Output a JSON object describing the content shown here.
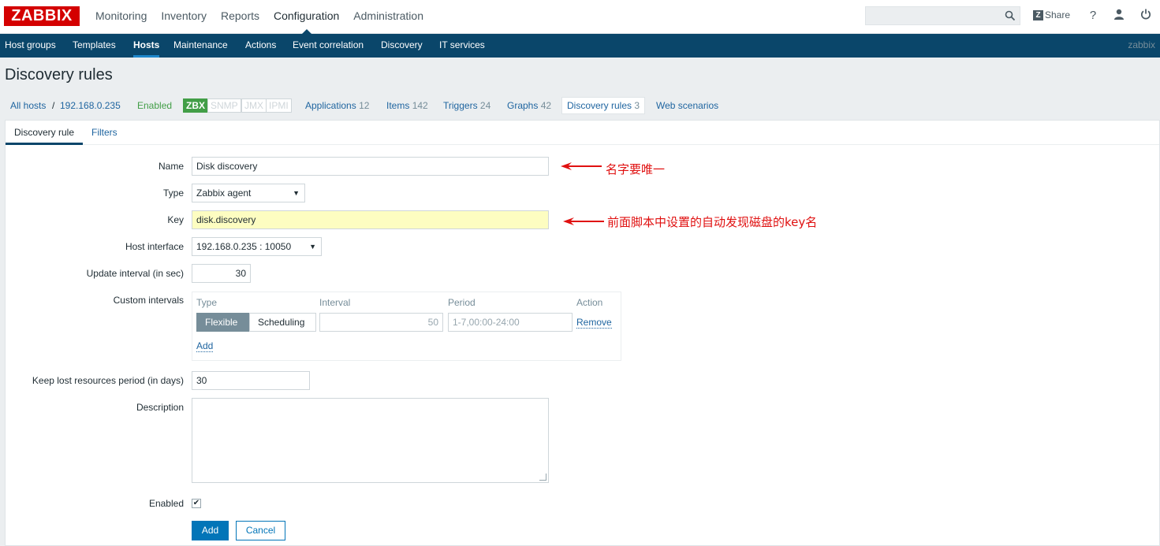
{
  "header": {
    "logo": "ZABBIX",
    "menu": [
      "Monitoring",
      "Inventory",
      "Reports",
      "Configuration",
      "Administration"
    ],
    "share": "Share",
    "help": "?"
  },
  "subnav": {
    "items": [
      "Host groups",
      "Templates",
      "Hosts",
      "Maintenance",
      "Actions",
      "Event correlation",
      "Discovery",
      "IT services"
    ],
    "server_name": "zabbix"
  },
  "page": {
    "title": "Discovery rules"
  },
  "host_nav": {
    "all_hosts": "All hosts",
    "separator": "/",
    "host": "192.168.0.235",
    "status": "Enabled",
    "interfaces": [
      "ZBX",
      "SNMP",
      "JMX",
      "IPMI"
    ],
    "applications": {
      "label": "Applications",
      "count": "12"
    },
    "items": {
      "label": "Items",
      "count": "142"
    },
    "triggers": {
      "label": "Triggers",
      "count": "24"
    },
    "graphs": {
      "label": "Graphs",
      "count": "42"
    },
    "discovery_rules": {
      "label": "Discovery rules",
      "count": "3"
    },
    "web_scenarios": {
      "label": "Web scenarios"
    }
  },
  "tabs": [
    "Discovery rule",
    "Filters"
  ],
  "form": {
    "name": {
      "label": "Name",
      "value": "Disk discovery"
    },
    "type": {
      "label": "Type",
      "value": "Zabbix agent"
    },
    "key": {
      "label": "Key",
      "value": "disk.discovery"
    },
    "host_interface": {
      "label": "Host interface",
      "value": "192.168.0.235 : 10050"
    },
    "update_interval": {
      "label": "Update interval (in sec)",
      "value": "30"
    },
    "custom_intervals": {
      "label": "Custom intervals",
      "headers": [
        "Type",
        "Interval",
        "Period",
        "Action"
      ],
      "type_options": [
        "Flexible",
        "Scheduling"
      ],
      "interval": "50",
      "period": "1-7,00:00-24:00",
      "remove": "Remove",
      "add": "Add"
    },
    "keep_lost": {
      "label": "Keep lost resources period (in days)",
      "value": "30"
    },
    "description": {
      "label": "Description",
      "value": ""
    },
    "enabled": {
      "label": "Enabled",
      "checked": true,
      "mark": "✔"
    },
    "buttons": {
      "add": "Add",
      "cancel": "Cancel"
    }
  },
  "annotations": {
    "name_note": "名字要唯一",
    "key_note": "前面脚本中设置的自动发现磁盘的key名"
  }
}
